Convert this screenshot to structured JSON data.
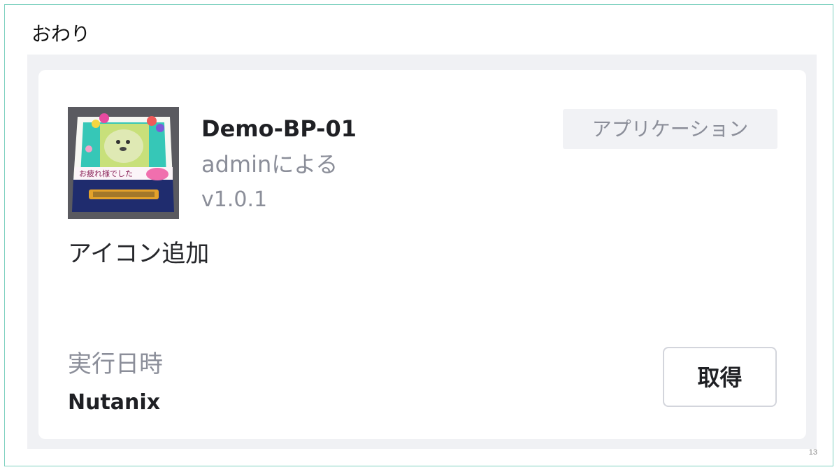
{
  "slide": {
    "title": "おわり",
    "page_number": "13"
  },
  "card": {
    "icon": "blueprint-box-image",
    "name": "Demo-BP-01",
    "owner": "adminによる",
    "version": "v1.0.1",
    "type_badge": "アプリケーション",
    "description": "アイコン追加",
    "project_label": "実行日時",
    "project_value": "Nutanix",
    "get_button_label": "取得"
  },
  "colors": {
    "slide_border": "#7fd1c0",
    "panel_background": "#f0f1f4",
    "card_background": "#ffffff",
    "muted_text": "#8b8e99",
    "strong_text": "#1f2024",
    "badge_background": "#f1f2f5",
    "button_border": "#d3d5dc"
  }
}
